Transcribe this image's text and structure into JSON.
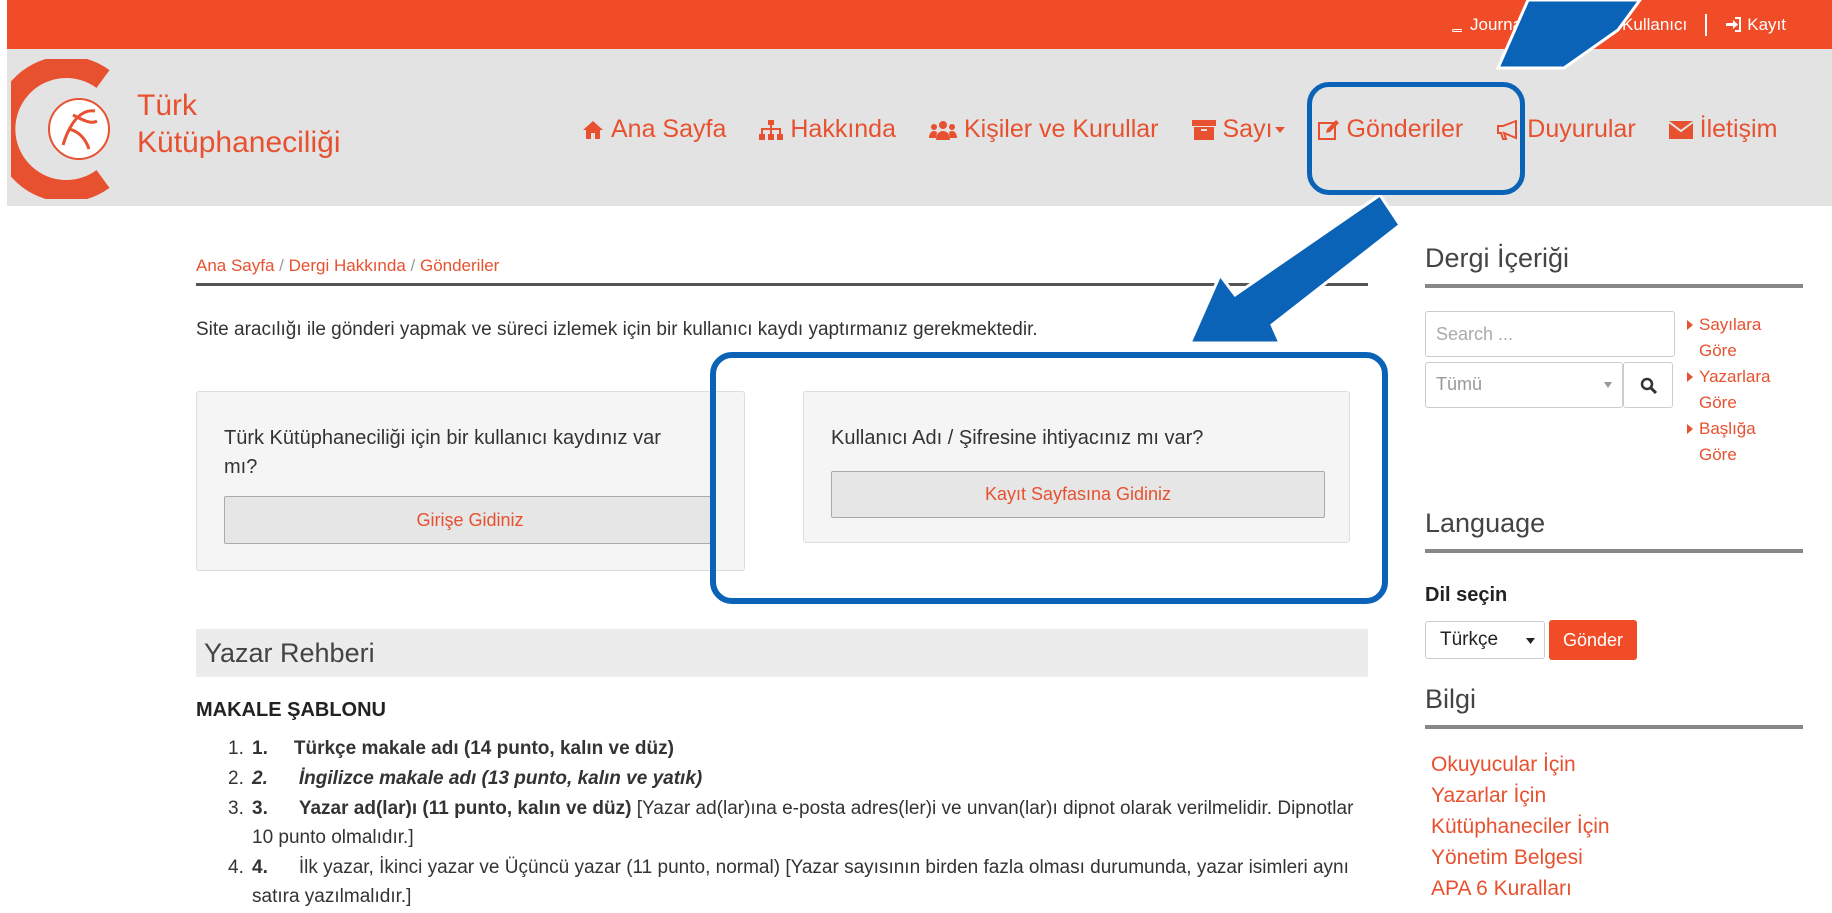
{
  "topbar": {
    "links": [
      {
        "label": "Journals",
        "icon": "book-icon"
      },
      {
        "label": "Kullanıcı",
        "icon": "key-icon"
      },
      {
        "label": "Kayıt",
        "icon": "sign-in-icon"
      }
    ]
  },
  "brand": {
    "line1": "Türk",
    "line2": "Kütüphaneciliği"
  },
  "nav": [
    {
      "label": "Ana Sayfa",
      "icon": "home-icon"
    },
    {
      "label": "Hakkında",
      "icon": "sitemap-icon"
    },
    {
      "label": "Kişiler ve Kurullar",
      "icon": "users-icon"
    },
    {
      "label": "Sayı",
      "icon": "archive-icon"
    },
    {
      "label": "Gönderiler",
      "icon": "edit-icon"
    },
    {
      "label": "Duyurular",
      "icon": "bullhorn-icon"
    },
    {
      "label": "İletişim",
      "icon": "envelope-icon"
    }
  ],
  "breadcrumb": {
    "home": "Ana Sayfa",
    "sep": " / ",
    "about": "Dergi Hakkında",
    "current": "Gönderiler"
  },
  "intro": "Site aracılığı ile gönderi yapmak ve süreci izlemek için bir kullanıcı kaydı yaptırmanız gerekmektedir.",
  "box_login": {
    "text": "Türk Kütüphaneciliği için bir kullanıcı kaydınız var mı?",
    "button": "Girişe Gidiniz"
  },
  "box_register": {
    "text": "Kullanıcı Adı / Şifresine ihtiyacınız mı var?",
    "button": "Kayıt Sayfasına Gidiniz"
  },
  "author_guide": {
    "title": "Yazar Rehberi",
    "template_heading": "MAKALE ŞABLONU",
    "items": [
      {
        "n": "1.",
        "num": "1.",
        "bold": "Türkçe makale adı (14 punto, kalın ve düz)",
        "rest": ""
      },
      {
        "n": "2.",
        "num": "2.",
        "bold": "İngilizce makale adı (13 punto, kalın ve yatık)",
        "rest": ""
      },
      {
        "n": "3.",
        "num": "3.",
        "bold": "Yazar ad(lar)ı (11 punto, kalın ve düz)",
        "rest": " [Yazar ad(lar)ına e-posta adres(ler)i ve unvan(lar)ı dipnot olarak verilmelidir. Dipnotlar 10 punto olmalıdır.]"
      },
      {
        "n": "4.",
        "num": "4.",
        "bold": "",
        "rest": "İlk yazar, İkinci yazar ve Üçüncü yazar (11 punto, normal) [Yazar sayısının birden fazla olması durumunda, yazar isimleri aynı satıra yazılmalıdır.]"
      }
    ]
  },
  "sidebar": {
    "journal_title": "Dergi İçeriği",
    "search_placeholder": "Search ...",
    "scope_value": "Tümü",
    "browse": [
      {
        "label": "Sayılara Göre"
      },
      {
        "label": "Yazarlara Göre"
      },
      {
        "label": "Başlığa Göre"
      }
    ],
    "language_title": "Language",
    "language_label": "Dil seçin",
    "language_value": "Türkçe",
    "language_submit": "Gönder",
    "info_title": "Bilgi",
    "info_links": [
      "Okuyucular İçin",
      "Yazarlar İçin",
      "Kütüphaneciler İçin",
      "Yönetim Belgesi",
      "APA 6 Kuralları"
    ]
  },
  "colors": {
    "brand": "#f04c27",
    "annotation": "#0b63b8"
  }
}
